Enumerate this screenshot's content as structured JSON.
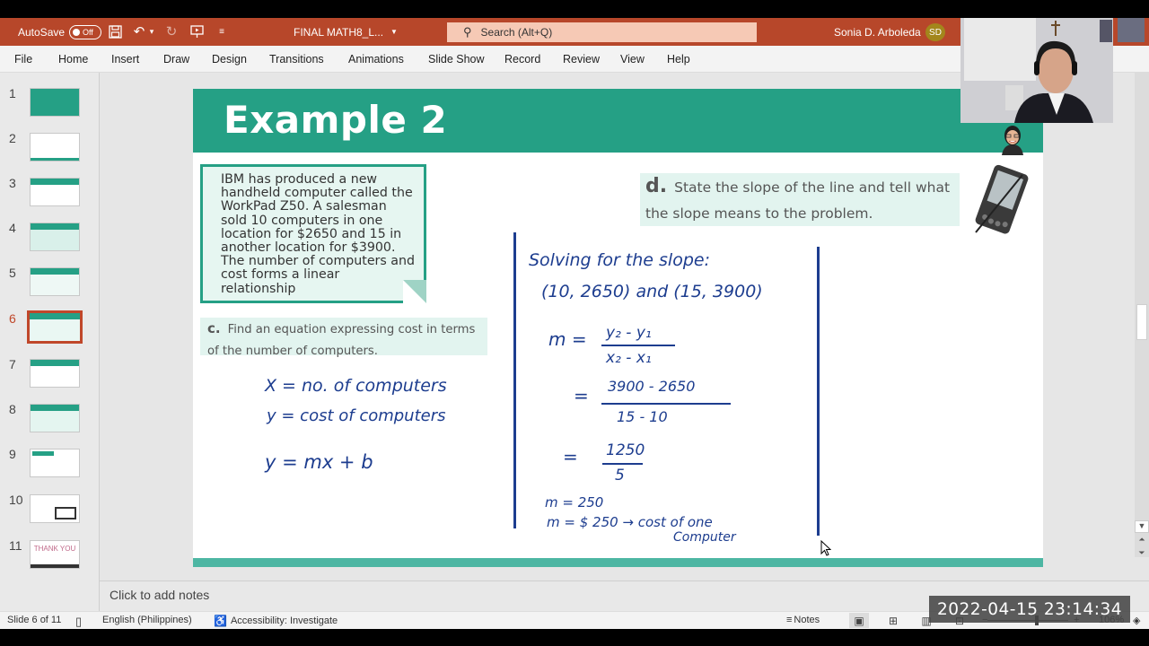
{
  "titlebar": {
    "autosave_label": "AutoSave",
    "autosave_state": "Off",
    "document_title": "FINAL MATH8_L...",
    "search_placeholder": "Search (Alt+Q)",
    "user_name": "Sonia  D. Arboleda",
    "user_initials": "SD",
    "quick_access_icons": [
      "save-icon",
      "undo-icon",
      "redo-icon",
      "present-icon",
      "customize-icon"
    ]
  },
  "ribbon": {
    "tabs": [
      "File",
      "Home",
      "Insert",
      "Draw",
      "Design",
      "Transitions",
      "Animations",
      "Slide Show",
      "Record",
      "Review",
      "View",
      "Help"
    ]
  },
  "thumbnails": {
    "active_index": 6,
    "items": [
      {
        "number": "1"
      },
      {
        "number": "2"
      },
      {
        "number": "3"
      },
      {
        "number": "4"
      },
      {
        "number": "5"
      },
      {
        "number": "6"
      },
      {
        "number": "7"
      },
      {
        "number": "8"
      },
      {
        "number": "9"
      },
      {
        "number": "10"
      },
      {
        "number": "11",
        "caption": "THANK YOU"
      }
    ]
  },
  "slide": {
    "title": "Example 2",
    "accent_color": "#25a085",
    "problem_text": "IBM has produced a new handheld computer called the WorkPad Z50.  A salesman sold 10 computers in one location for $2650 and 15 in another location for $3900. The number of computers and cost forms a linear relationship",
    "question_c": {
      "letter": "c.",
      "text": "Find an equation expressing cost in terms of the number of computers."
    },
    "question_d": {
      "letter": "d.",
      "text": "State the slope of the line and tell what the slope means to the problem."
    },
    "handwriting_left": [
      "X = no. of computers",
      "y = cost of computers",
      "y = mx + b"
    ],
    "handwriting_right": {
      "heading": "Solving for the slope:",
      "points": "(10, 2650) and (15, 3900)",
      "formula_lhs": "m =",
      "formula_num": "y₂ - y₁",
      "formula_den": "x₂ - x₁",
      "step1_num": "3900 - 2650",
      "step1_den": "15 - 10",
      "step2_num": "1250",
      "step2_den": "5",
      "eq_sign": "=",
      "result1": "m = 250",
      "result2": "m = $ 250 → cost of one",
      "result2_cont": "Computer"
    }
  },
  "notes": {
    "placeholder": "Click to add notes"
  },
  "statusbar": {
    "slide_indicator": "Slide 6 of 11",
    "language": "English (Philippines)",
    "accessibility": "Accessibility: Investigate",
    "notes_label": "Notes",
    "zoom_minus": "−",
    "zoom_plus": "+",
    "zoom_level": "106%"
  },
  "overlay": {
    "timestamp": "2022-04-15  23:14:34"
  }
}
